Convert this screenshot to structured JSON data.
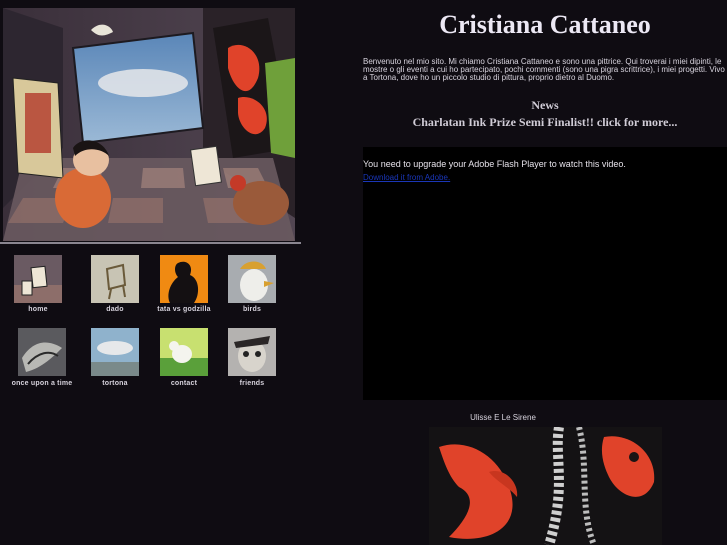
{
  "site": {
    "title": "Cristiana Cattaneo",
    "intro_lines": [
      "Benvenuto nel mio sito. Mi chiamo Cristiana Cattaneo e sono una pittrice. Qui troverai i miei dipinti, le",
      "mostre o gli eventi a cui ho partecipato, pochi commenti (sono una pigra scrittrice), i miei progetti. Vivo",
      "a Tortona, dove ho un piccolo studio di pittura, proprio dietro al Duomo."
    ]
  },
  "news": {
    "heading": "News",
    "link": "Charlatan Ink Prize Semi Finalist!! click for more..."
  },
  "flash": {
    "message": "You need to upgrade your Adobe Flash Player to watch this video.",
    "download_link": "Download it from Adobe."
  },
  "video": {
    "caption": "Ulisse E Le Sirene"
  },
  "nav": {
    "items": [
      {
        "label": "home",
        "icon": "cards-house-icon"
      },
      {
        "label": "dado",
        "icon": "dice-icon"
      },
      {
        "label": "tata vs godzilla",
        "icon": "godzilla-icon"
      },
      {
        "label": "birds",
        "icon": "bird-icon"
      },
      {
        "label": "once upon a time",
        "icon": "hands-icon"
      },
      {
        "label": "tortona",
        "icon": "fish-icon"
      },
      {
        "label": "contact",
        "icon": "sheep-icon"
      },
      {
        "label": "friends",
        "icon": "face-icon"
      }
    ]
  },
  "colors": {
    "background": "#0f0c12",
    "text": "#e8e4ee",
    "link_blue": "#1a36b8",
    "accent_red": "#e0432a"
  }
}
